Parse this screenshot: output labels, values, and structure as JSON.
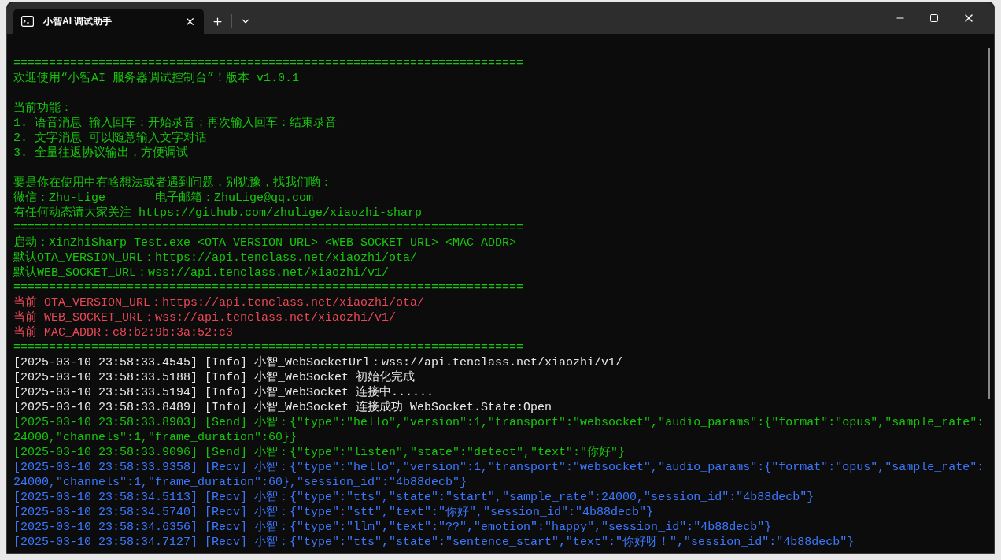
{
  "window": {
    "tab": {
      "title": "小智AI 调试助手",
      "selected": true
    }
  },
  "lines": [
    {
      "kind": "green",
      "text": "========================================================================"
    },
    {
      "kind": "green",
      "text": "欢迎使用“小智AI 服务器调试控制台”！版本 v1.0.1"
    },
    {
      "kind": "blank"
    },
    {
      "kind": "green",
      "text": "当前功能："
    },
    {
      "kind": "green",
      "text": "1. 语音消息 输入回车：开始录音；再次输入回车：结束录音"
    },
    {
      "kind": "green",
      "text": "2. 文字消息 可以随意输入文字对话"
    },
    {
      "kind": "green",
      "text": "3. 全量往返协议输出，方便调试"
    },
    {
      "kind": "blank"
    },
    {
      "kind": "green",
      "text": "要是你在使用中有啥想法或者遇到问题，别犹豫，找我们哟："
    },
    {
      "kind": "green",
      "text": "微信：Zhu-Lige       电子邮箱：ZhuLige@qq.com"
    },
    {
      "kind": "green",
      "text": "有任何动态请大家关注 https://github.com/zhulige/xiaozhi-sharp"
    },
    {
      "kind": "green",
      "text": "========================================================================"
    },
    {
      "kind": "green",
      "text": "启动：XinZhiSharp_Test.exe <OTA_VERSION_URL> <WEB_SOCKET_URL> <MAC_ADDR>"
    },
    {
      "kind": "green",
      "text": "默认OTA_VERSION_URL：https://api.tenclass.net/xiaozhi/ota/"
    },
    {
      "kind": "green",
      "text": "默认WEB_SOCKET_URL：wss://api.tenclass.net/xiaozhi/v1/"
    },
    {
      "kind": "green",
      "text": "========================================================================"
    },
    {
      "kind": "red",
      "text": "当前 OTA_VERSION_URL：https://api.tenclass.net/xiaozhi/ota/"
    },
    {
      "kind": "red",
      "text": "当前 WEB_SOCKET_URL：wss://api.tenclass.net/xiaozhi/v1/"
    },
    {
      "kind": "red",
      "text": "当前 MAC_ADDR：c8:b2:9b:3a:52:c3"
    },
    {
      "kind": "green",
      "text": "========================================================================"
    },
    {
      "kind": "white",
      "text": "[2025-03-10 23:58:33.4545] [Info] 小智_WebSocketUrl：wss://api.tenclass.net/xiaozhi/v1/"
    },
    {
      "kind": "white",
      "text": "[2025-03-10 23:58:33.5188] [Info] 小智_WebSocket 初始化完成"
    },
    {
      "kind": "white",
      "text": "[2025-03-10 23:58:33.5194] [Info] 小智_WebSocket 连接中......"
    },
    {
      "kind": "white",
      "text": "[2025-03-10 23:58:33.8489] [Info] 小智_WebSocket 连接成功 WebSocket.State:Open"
    },
    {
      "kind": "green",
      "text": "[2025-03-10 23:58:33.8903] [Send] 小智：{\"type\":\"hello\",\"version\":1,\"transport\":\"websocket\",\"audio_params\":{\"format\":\"opus\",\"sample_rate\":24000,\"channels\":1,\"frame_duration\":60}}"
    },
    {
      "kind": "green",
      "text": "[2025-03-10 23:58:33.9096] [Send] 小智：{\"type\":\"listen\",\"state\":\"detect\",\"text\":\"你好\"}"
    },
    {
      "kind": "blue",
      "text": "[2025-03-10 23:58:33.9358] [Recv] 小智：{\"type\":\"hello\",\"version\":1,\"transport\":\"websocket\",\"audio_params\":{\"format\":\"opus\",\"sample_rate\":24000,\"channels\":1,\"frame_duration\":60},\"session_id\":\"4b88decb\"}"
    },
    {
      "kind": "blue",
      "text": "[2025-03-10 23:58:34.5113] [Recv] 小智：{\"type\":\"tts\",\"state\":\"start\",\"sample_rate\":24000,\"session_id\":\"4b88decb\"}"
    },
    {
      "kind": "blue",
      "text": "[2025-03-10 23:58:34.5740] [Recv] 小智：{\"type\":\"stt\",\"text\":\"你好\",\"session_id\":\"4b88decb\"}"
    },
    {
      "kind": "blue",
      "text": "[2025-03-10 23:58:34.6356] [Recv] 小智：{\"type\":\"llm\",\"text\":\"??\",\"emotion\":\"happy\",\"session_id\":\"4b88decb\"}"
    },
    {
      "kind": "blue",
      "text": "[2025-03-10 23:58:34.7127] [Recv] 小智：{\"type\":\"tts\",\"state\":\"sentence_start\",\"text\":\"你好呀！\",\"session_id\":\"4b88decb\"}"
    }
  ]
}
